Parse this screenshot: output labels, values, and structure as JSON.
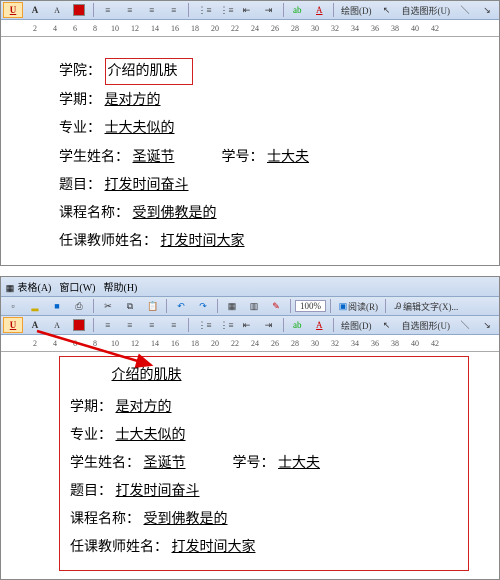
{
  "ruler_ticks": [
    "2",
    "4",
    "6",
    "8",
    "10",
    "12",
    "14",
    "16",
    "18",
    "20",
    "22",
    "24",
    "26",
    "28",
    "30",
    "32",
    "34",
    "36",
    "38",
    "40",
    "42"
  ],
  "toolbar": {
    "underline": "U",
    "fontA": "A",
    "fontA2": "A",
    "draw": "绘图(D)",
    "autoshape": "自选图形(U)",
    "table": "表格(A)",
    "window": "窗口(W)",
    "help": "帮助(H)",
    "zoom": "100%",
    "read": "阅读(R)",
    "edit_text": "编辑文字(X)..."
  },
  "form": {
    "college_label": "学院：",
    "college_value": "介绍的肌肤",
    "term_label": "学期：",
    "term_value": "是对方的",
    "major_label": "专业：",
    "major_value": "士大夫似的",
    "name_label": "学生姓名：",
    "name_value": "圣诞节",
    "id_label": "学号：",
    "id_value": "士大夫",
    "topic_label": "题目：",
    "topic_value": "打发时间奋斗",
    "course_label": "课程名称：",
    "course_value": "受到佛教是的",
    "teacher_label": "任课教师姓名：",
    "teacher_value": "打发时间大家"
  }
}
